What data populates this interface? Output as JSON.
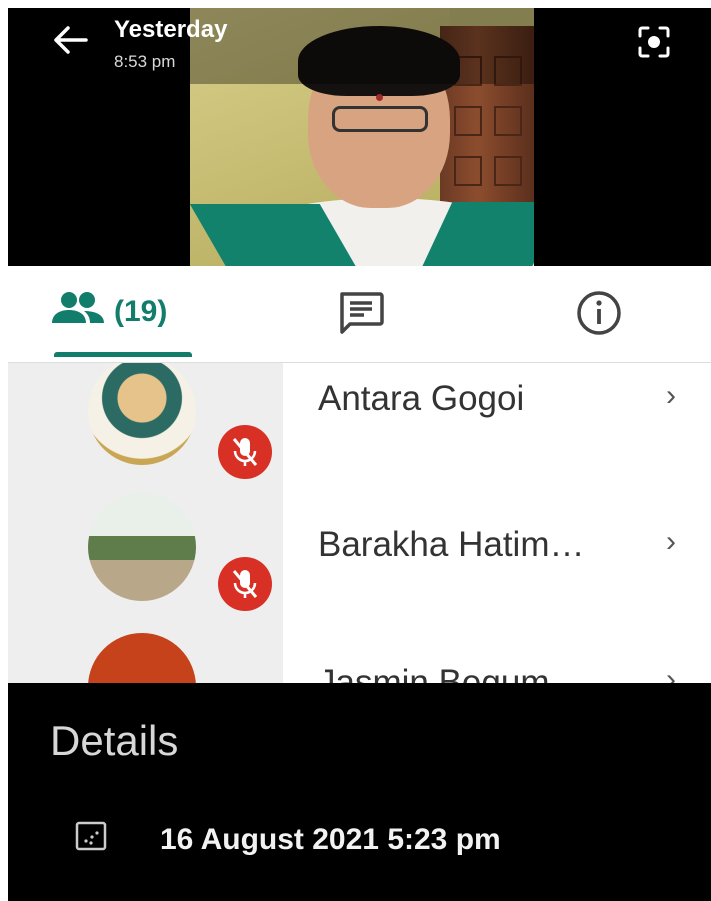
{
  "header": {
    "title": "Yesterday",
    "time": "8:53 pm",
    "back_icon": "arrow-left-icon",
    "camera_icon": "camera-switch-icon"
  },
  "tabs": {
    "people_count": "(19)",
    "people_icon": "people-icon",
    "chat_icon": "chat-icon",
    "info_icon": "info-icon",
    "accent": "#137d6c"
  },
  "participants": [
    {
      "name": "Antara Gogoi",
      "muted": true
    },
    {
      "name": "Barakha Hatim…",
      "muted": true
    },
    {
      "name": "Jasmin Begum",
      "muted": false,
      "avatar_color": "#c5421b"
    }
  ],
  "details": {
    "title": "Details",
    "date": "16 August 2021 5:23 pm",
    "date_icon": "calendar-icon"
  },
  "colors": {
    "mute_red": "#d93025",
    "sheet_bg": "#000000"
  }
}
